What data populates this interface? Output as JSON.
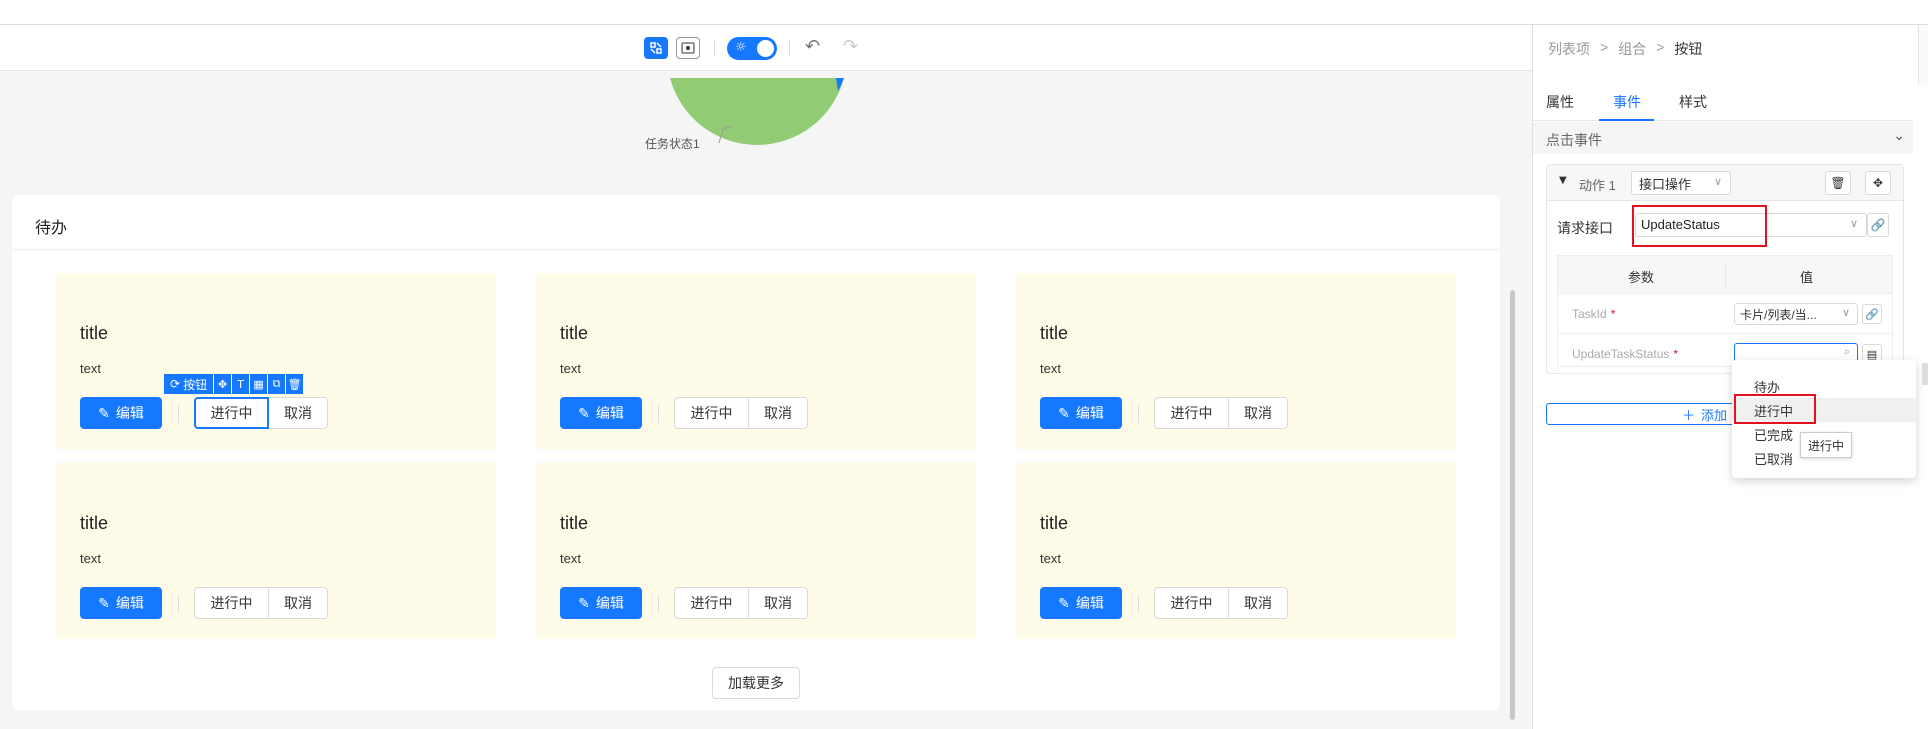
{
  "toolbar": {
    "tools": [
      "layout-icon",
      "preview-icon"
    ],
    "theme_toggle": "sun-icon",
    "undo": "undo-icon",
    "redo": "redo-icon"
  },
  "chart": {
    "pie_label": "任务状态1",
    "slice_colors": [
      "#91cc75",
      "#1677ff"
    ]
  },
  "todo": {
    "title": "待办",
    "items": [
      {
        "title": "title",
        "text": "text",
        "edit": "编辑",
        "status": "进行中",
        "cancel": "取消"
      },
      {
        "title": "title",
        "text": "text",
        "edit": "编辑",
        "status": "进行中",
        "cancel": "取消"
      },
      {
        "title": "title",
        "text": "text",
        "edit": "编辑",
        "status": "进行中",
        "cancel": "取消"
      },
      {
        "title": "title",
        "text": "text",
        "edit": "编辑",
        "status": "进行中",
        "cancel": "取消"
      },
      {
        "title": "title",
        "text": "text",
        "edit": "编辑",
        "status": "进行中",
        "cancel": "取消"
      },
      {
        "title": "title",
        "text": "text",
        "edit": "编辑",
        "status": "进行中",
        "cancel": "取消"
      }
    ],
    "load_more": "加载更多",
    "selection_label": "按钮"
  },
  "panel": {
    "breadcrumb": [
      "列表项",
      "组合",
      "按钮"
    ],
    "tabs": [
      "属性",
      "事件",
      "样式"
    ],
    "section": "点击事件",
    "action": {
      "name": "动作 1",
      "type": "接口操作",
      "request_label": "请求接口",
      "request_value": "UpdateStatus",
      "table_headers": [
        "参数",
        "值"
      ],
      "params": [
        {
          "name": "TaskId",
          "value": "卡片/列表/当..."
        },
        {
          "name": "UpdateTaskStatus",
          "value": ""
        }
      ]
    },
    "add_label": "添加"
  },
  "dropdown": {
    "options": [
      "待办",
      "进行中",
      "已完成",
      "已取消"
    ],
    "tooltip": "进行中"
  },
  "colors": {
    "accent": "#1677ff",
    "highlight": "#e3101e",
    "card_bg": "#fffbe9"
  }
}
